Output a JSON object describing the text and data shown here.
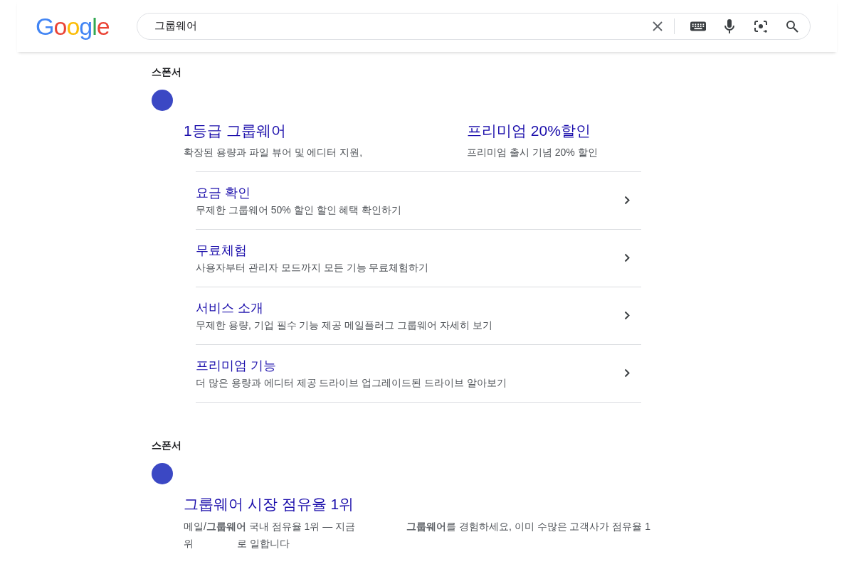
{
  "logo": "Google",
  "search": {
    "value": "그룹웨어"
  },
  "ads": [
    {
      "kind": "sitelinks",
      "label": "스폰서",
      "columns": [
        {
          "title": "1등급 그룹웨어",
          "description": "확장된 용량과 파일 뷰어 및 에디터 지원,"
        },
        {
          "title": "프리미엄 20%할인",
          "description": "프리미엄 출시 기념 20% 할인"
        }
      ],
      "sitelinks": [
        {
          "title": "요금 확인",
          "description": "무제한 그룹웨어 50% 할인 할인 혜택 확인하기"
        },
        {
          "title": "무료체험",
          "description": "사용자부터 관리자 모드까지 모든 기능 무료체험하기"
        },
        {
          "title": "서비스 소개",
          "description": "무제한 용량, 기업 필수 기능 제공 메일플러그 그룹웨어 자세히 보기"
        },
        {
          "title": "프리미엄 기능",
          "description": "더 많은 용량과 에디터 제공 드라이브 업그레이드된 드라이브 알아보기"
        }
      ]
    },
    {
      "kind": "text",
      "label": "스폰서",
      "title": "그룹웨어 시장 점유율 1위",
      "description_lines": [
        [
          "메일/**그룹웨어** 국내 점유율 1위 — 지금",
          "**그룹웨어**를 경험하세요, 이미 수많은 고객사가 점유율 1"
        ],
        [
          "위",
          "로 일합니다"
        ]
      ]
    }
  ]
}
